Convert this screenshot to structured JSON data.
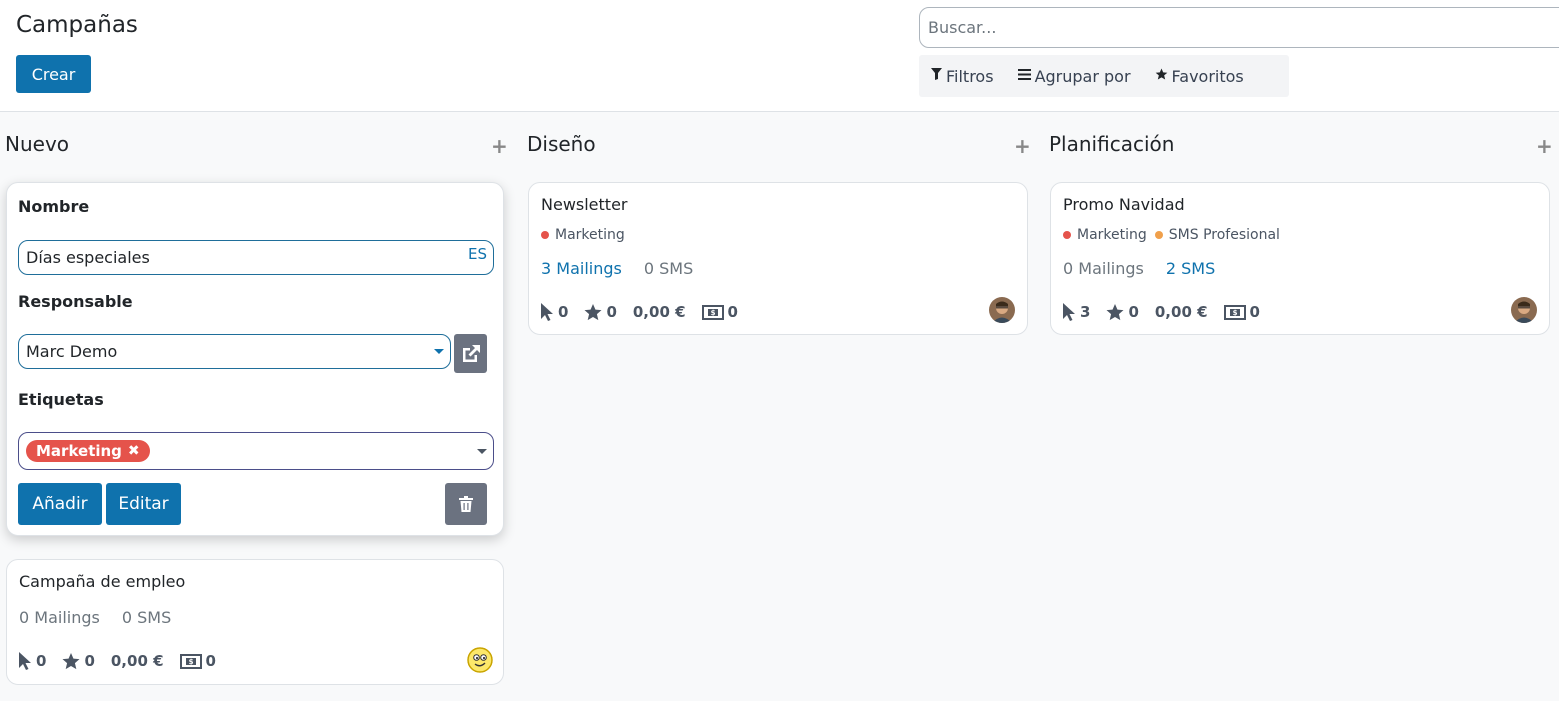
{
  "header": {
    "title": "Campañas",
    "create_label": "Crear",
    "search_placeholder": "Buscar...",
    "filters_label": "Filtros",
    "groupby_label": "Agrupar por",
    "favorites_label": "Favoritos"
  },
  "columns": [
    {
      "title": "Nuevo"
    },
    {
      "title": "Diseño"
    },
    {
      "title": "Planificación"
    }
  ],
  "quick_create": {
    "name_label": "Nombre",
    "name_value": "Días especiales",
    "lang_code": "ES",
    "responsible_label": "Responsable",
    "responsible_value": "Marc Demo",
    "tags_label": "Etiquetas",
    "tag_value": "Marketing",
    "add_label": "Añadir",
    "edit_label": "Editar"
  },
  "cards": {
    "empleo": {
      "title": "Campaña de empleo",
      "mailings": "0 Mailings",
      "sms": "0 SMS",
      "clicks": "0",
      "stars": "0",
      "revenue": "0,00 €",
      "orders": "0"
    },
    "newsletter": {
      "title": "Newsletter",
      "tag1": "Marketing",
      "mailings": "3 Mailings",
      "sms": "0 SMS",
      "clicks": "0",
      "stars": "0",
      "revenue": "0,00 €",
      "orders": "0"
    },
    "navidad": {
      "title": "Promo Navidad",
      "tag1": "Marketing",
      "tag2": "SMS Profesional",
      "mailings": "0 Mailings",
      "sms": "2 SMS",
      "clicks": "3",
      "stars": "0",
      "revenue": "0,00 €",
      "orders": "0"
    }
  },
  "colors": {
    "primary": "#0f72ad",
    "tag_marketing": "#e5534b",
    "tag_sms": "#f0a04b"
  }
}
